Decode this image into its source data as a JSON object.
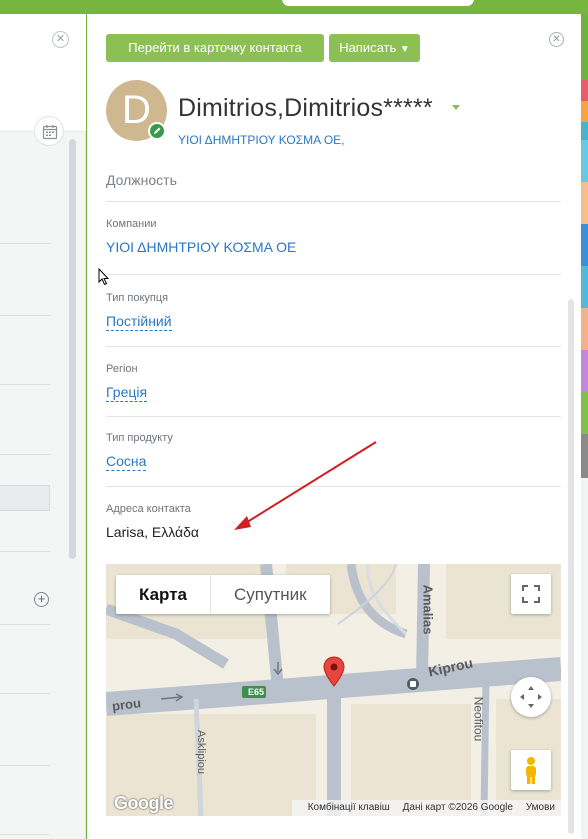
{
  "header": {
    "open_card_button": "Перейти в карточку контакта",
    "write_button": "Написать"
  },
  "contact": {
    "avatar_letter": "D",
    "name": "Dimitrios,Dimitrios*****",
    "company_link": "ΥΙΟΙ ΔΗΜΗΤΡΙΟΥ ΚΟΣΜΑ ΟΕ,"
  },
  "fields": {
    "position_label": "Должность",
    "companies_label": "Компании",
    "companies_value": "ΥΙΟΙ ΔΗΜΗΤΡΙΟΥ ΚΟΣΜΑ ΟΕ",
    "buyer_type_label": "Тип покупця",
    "buyer_type_value": "Постійний",
    "region_label": "Регіон",
    "region_value": "Греція",
    "product_type_label": "Тип продукту",
    "product_type_value": "Сосна",
    "address_label": "Адреса контакта",
    "address_value": "Larisa, Ελλάδα"
  },
  "map": {
    "tab_map": "Карта",
    "tab_satellite": "Супутник",
    "street_kiprou": "Kiprou",
    "street_kiprou_left": "prou",
    "street_amalias": "Amalias",
    "street_asklipiou": "Asklipiou",
    "street_neofitou": "Neofitou",
    "road_badge": "E65",
    "logo": "Google",
    "footer_shortcuts": "Комбінації клавіш",
    "footer_data": "Дані карт ©2026 Google",
    "footer_terms": "Умови"
  },
  "colors": {
    "accent_green": "#8cbf54",
    "link_blue": "#2a77c5",
    "tab_strip": [
      "#e85b6a",
      "#f5a442",
      "#4bb3c8",
      "#4bc8a8",
      "#6ac7e0",
      "#f2c08c",
      "#3e8ed6",
      "#54b8d8",
      "#f0b28a",
      "#c08ad8",
      "#7fc14a",
      "#8a8a8a"
    ]
  }
}
